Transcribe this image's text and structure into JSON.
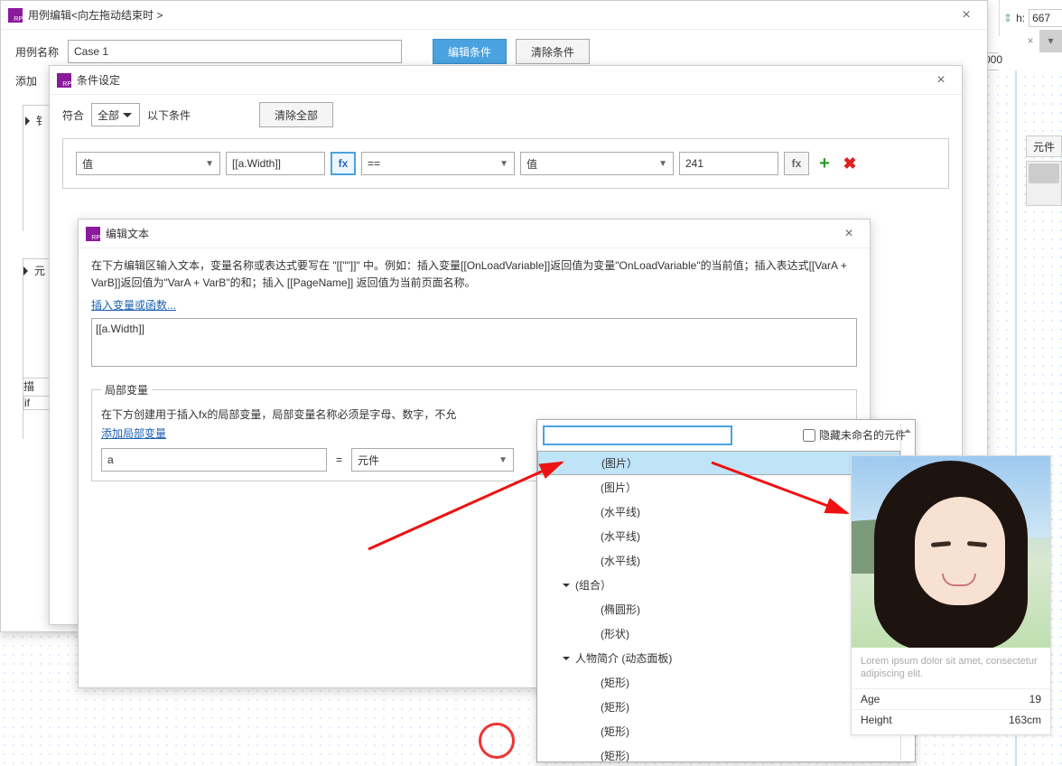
{
  "topright": {
    "h_label": "h:",
    "h_value": "667"
  },
  "ruler": {
    "mark": "000"
  },
  "dlg1": {
    "title": "用例编辑<向左拖动结束时 >",
    "case_label": "用例名称",
    "case_value": "Case 1",
    "btn_edit": "编辑条件",
    "btn_clear": "清除条件",
    "add_label": "添加"
  },
  "stub1": {
    "a": "钅",
    "b": "元"
  },
  "stub2": {
    "a": "描",
    "b": "if"
  },
  "dlg2": {
    "title": "条件设定",
    "match_prefix": "符合",
    "match_sel": "全部",
    "match_suffix": "以下条件",
    "btn_clear": "清除全部",
    "c_type1": "值",
    "c_val1": "[[a.Width]]",
    "c_op": "==",
    "c_type2": "值",
    "c_val2": "241"
  },
  "sidepeek": {
    "label": "元件"
  },
  "dlg3": {
    "title": "编辑文本",
    "desc": "在下方编辑区输入文本，变量名称或表达式要写在 \"[[\"\"]]\" 中。例如：插入变量[[OnLoadVariable]]返回值为变量\"OnLoadVariable\"的当前值；插入表达式[[VarA + VarB]]返回值为\"VarA + VarB\"的和；插入 [[PageName]] 返回值为当前页面名称。",
    "link_insert": "插入变量或函数...",
    "expr": "[[a.Width]]",
    "legend": "局部变量",
    "lv_desc": "在下方创建用于插入fx的局部变量，局部变量名称必须是字母、数字，不允",
    "link_addlv": "添加局部变量",
    "lv_name": "a",
    "lv_eq": "=",
    "lv_type": "元件"
  },
  "popup": {
    "chk_label": "隐藏未命名的元件",
    "items": [
      {
        "label": "(图片）",
        "indent": 1,
        "sel": true
      },
      {
        "label": "(图片）",
        "indent": 1
      },
      {
        "label": "(水平线)",
        "indent": 1
      },
      {
        "label": "(水平线)",
        "indent": 1
      },
      {
        "label": "(水平线)",
        "indent": 1
      },
      {
        "label": "(组合）",
        "indent": 0,
        "group": true
      },
      {
        "label": "(椭圆形)",
        "indent": 1
      },
      {
        "label": "(形状)",
        "indent": 1
      },
      {
        "label": "人物简介 (动态面板)",
        "indent": 0,
        "group": true
      },
      {
        "label": "(矩形)",
        "indent": 1
      },
      {
        "label": "(矩形)",
        "indent": 1
      },
      {
        "label": "(矩形)",
        "indent": 1
      },
      {
        "label": "(矩形)",
        "indent": 1
      }
    ]
  },
  "card": {
    "lorem": "Lorem ipsum dolor sit amet, consectetur adipiscing elit.",
    "age_l": "Age",
    "age_v": "19",
    "h_l": "Height",
    "h_v": "163cm"
  }
}
